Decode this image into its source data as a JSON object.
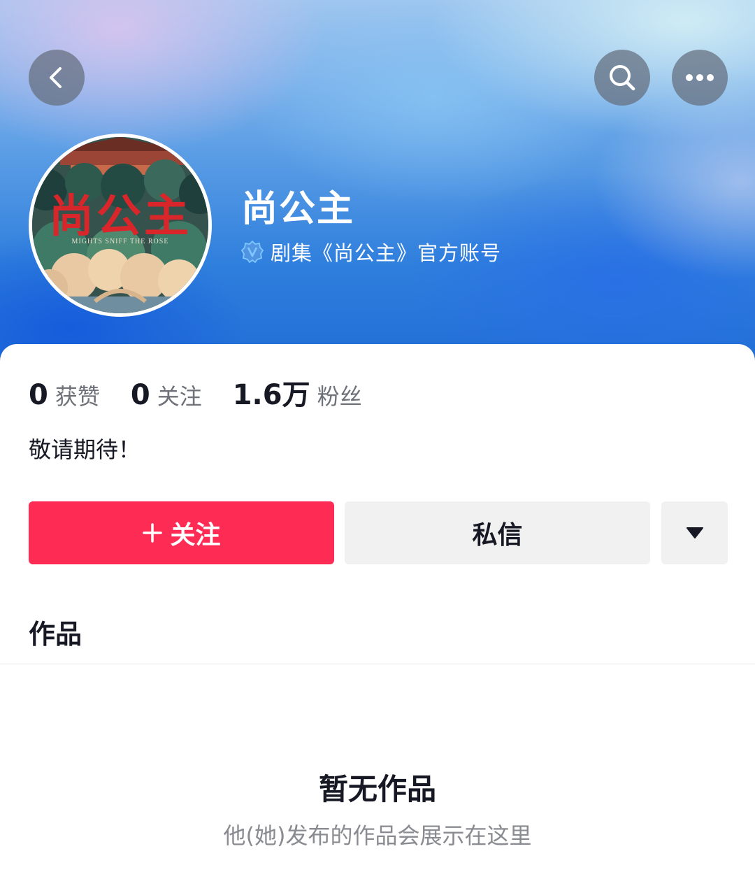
{
  "header": {
    "back_icon": "chevron-left-icon",
    "search_icon": "search-icon",
    "more_icon": "more-horizontal-icon"
  },
  "profile": {
    "name": "尚公主",
    "verification": "剧集《尚公主》官方账号",
    "verified_icon": "verified-badge-icon",
    "avatar": {
      "title_text": "尚公主",
      "subtitle_text": "MIGHTS SNIFF THE ROSE"
    }
  },
  "stats": [
    {
      "value": "0",
      "label": "获赞"
    },
    {
      "value": "0",
      "label": "关注"
    },
    {
      "value": "1.6万",
      "label": "粉丝"
    }
  ],
  "bio": "敬请期待！",
  "actions": {
    "follow_label": "关注",
    "message_label": "私信",
    "dropdown_icon": "triangle-down-icon"
  },
  "tabs": {
    "works_label": "作品"
  },
  "empty_state": {
    "title": "暂无作品",
    "subtitle": "他(她)发布的作品会展示在这里"
  },
  "colors": {
    "follow": "#fe2c55",
    "secondary_button": "#f1f1f2",
    "text_primary": "#161823",
    "text_secondary": "#8a8b91"
  }
}
